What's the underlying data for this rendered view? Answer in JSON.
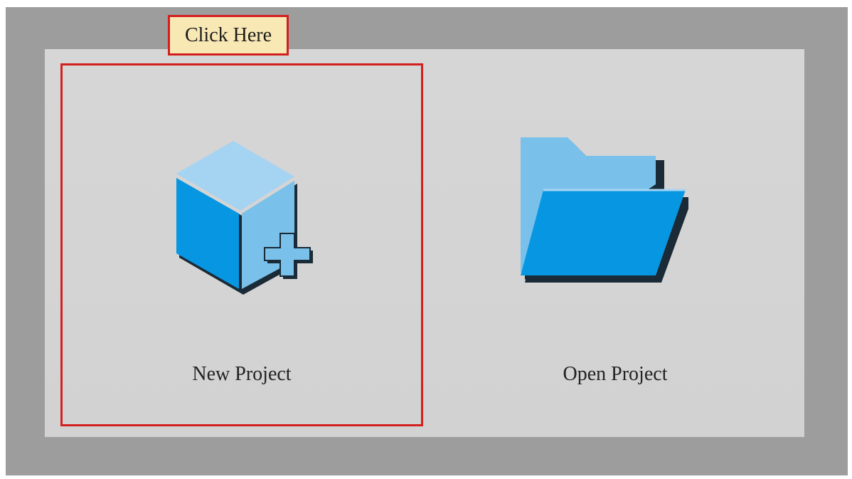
{
  "callout": {
    "text": "Click Here"
  },
  "tiles": [
    {
      "label": "New Project",
      "icon": "new-project-cube-plus-icon"
    },
    {
      "label": "Open Project",
      "icon": "open-folder-icon"
    }
  ],
  "colors": {
    "frame": "#9d9d9d",
    "panel": "#d4d4d4",
    "highlight": "#d41f1f",
    "callout_bg": "#f8e8b4",
    "icon_light": "#a5d3f2",
    "icon_mid": "#79c1ea",
    "icon_dark": "#0797e2",
    "icon_shadow": "#1a2a36"
  }
}
